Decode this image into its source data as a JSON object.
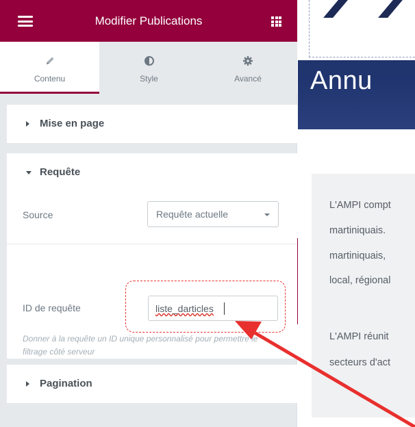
{
  "editor": {
    "title": "Modifier Publications",
    "tabs": [
      {
        "label": "Contenu",
        "icon": "pencil-icon",
        "active": true
      },
      {
        "label": "Style",
        "icon": "contrast-icon",
        "active": false
      },
      {
        "label": "Avancé",
        "icon": "gear-icon",
        "active": false
      }
    ],
    "sections": {
      "layout": "Mise en page",
      "query": "Requête",
      "pagination": "Pagination"
    },
    "source": {
      "label": "Source",
      "value": "Requête actuelle"
    },
    "query_id": {
      "label": "ID de requête",
      "value": "liste_darticles",
      "help": "Donner à la requête un ID unique personnalisé pour permettre le filtrage côté serveur"
    }
  },
  "preview": {
    "hero_title": "Annu",
    "paragraph_lines": [
      "L'AMPI compt",
      "martiniquais.",
      "martiniquais, ",
      "local, régional"
    ],
    "paragraph2_lines": [
      "L'AMPI réunit",
      "secteurs d'act"
    ]
  },
  "colors": {
    "brand": "#93003c",
    "annotation": "#e8302e",
    "hero": "#20356f"
  }
}
